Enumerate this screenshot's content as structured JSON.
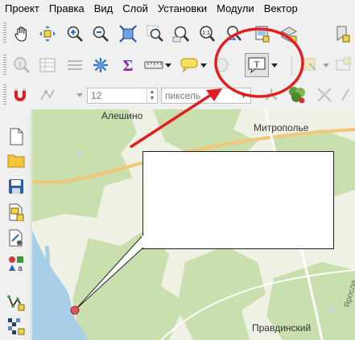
{
  "menu": {
    "items": [
      {
        "label": "Проект"
      },
      {
        "label": "Правка"
      },
      {
        "label": "Вид"
      },
      {
        "label": "Слой"
      },
      {
        "label": "Установки"
      },
      {
        "label": "Модули"
      },
      {
        "label": "Вектор"
      }
    ]
  },
  "toolbar3": {
    "size_value": "12",
    "units_value": "пиксель"
  },
  "map": {
    "places": [
      {
        "name": "Алешино"
      },
      {
        "name": "Митрополье"
      },
      {
        "name": "Правдинский"
      },
      {
        "name": "Яросла"
      }
    ]
  },
  "colors": {
    "highlight_circle": "#e02020",
    "arrow": "#e02020",
    "map_green": "#c9dfad",
    "map_base": "#eef1e4",
    "water": "#a9cfe8",
    "road": "#f2c77a",
    "marker": "#d9575f"
  }
}
